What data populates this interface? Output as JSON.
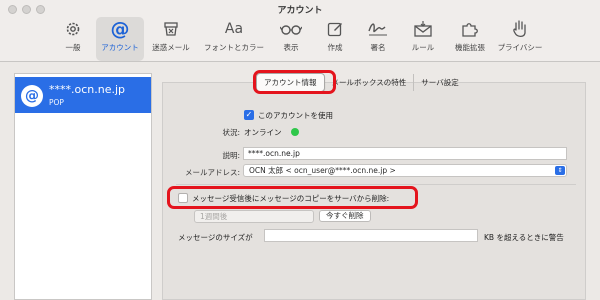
{
  "window": {
    "title": "アカウント"
  },
  "toolbar": {
    "items": [
      {
        "label": "一般",
        "icon": "gear-icon"
      },
      {
        "label": "アカウント",
        "icon": "at-sign-icon",
        "active": true
      },
      {
        "label": "迷惑メール",
        "icon": "junk-trash-icon"
      },
      {
        "label": "フォントとカラー",
        "icon": "font-icon",
        "glyph": "Aa"
      },
      {
        "label": "表示",
        "icon": "glasses-icon"
      },
      {
        "label": "作成",
        "icon": "compose-icon"
      },
      {
        "label": "署名",
        "icon": "signature-icon"
      },
      {
        "label": "ルール",
        "icon": "rules-envelope-icon"
      },
      {
        "label": "機能拡張",
        "icon": "puzzle-icon"
      },
      {
        "label": "プライバシー",
        "icon": "hand-icon"
      }
    ]
  },
  "accounts": [
    {
      "name": "****.ocn.ne.jp",
      "type": "POP",
      "selected": true
    }
  ],
  "tabs": [
    {
      "label": "アカウント情報",
      "selected": true
    },
    {
      "label": "メールボックスの特性"
    },
    {
      "label": "サーバ設定"
    }
  ],
  "form": {
    "enable_label": "このアカウントを使用",
    "enable_checked": true,
    "status_label": "状況:",
    "status_value": "オンライン",
    "status_color": "#2fc74a",
    "description_label": "説明:",
    "description_value": "****.ocn.ne.jp",
    "email_label": "メールアドレス:",
    "email_value": "OCN 太郎 < ocn_user@****.ocn.ne.jp >",
    "remove_copy_label": "メッセージ受信後にメッセージのコピーをサーバから削除:",
    "remove_copy_checked": false,
    "period_value": "1週間後",
    "remove_now_label": "今すぐ削除",
    "size_label": "メッセージのサイズが",
    "size_value": "",
    "size_suffix": "KB を超えるときに警告"
  },
  "colors": {
    "accent": "#2a6ee6",
    "highlight": "#e4141d"
  }
}
